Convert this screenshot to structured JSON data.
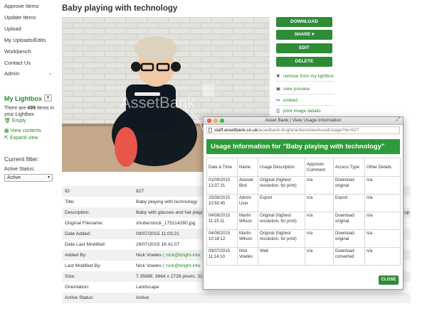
{
  "sidebar": {
    "nav": [
      {
        "label": "Approve Items"
      },
      {
        "label": "Update Items"
      },
      {
        "label": "Upload"
      },
      {
        "label": "My Uploads/Edits"
      },
      {
        "label": "Workbench"
      },
      {
        "label": "Contact Us"
      },
      {
        "label": "Admin"
      }
    ],
    "lightbox": {
      "title": "My Lightbox",
      "count_prefix": "There are ",
      "count": "499",
      "count_suffix": " items in your Lightbox",
      "empty": "Empty",
      "view_contents": "View contents",
      "expand_view": "Expand view"
    },
    "filter": {
      "title": "Current filter:",
      "label": "Active Status:",
      "value": "Active"
    }
  },
  "page": {
    "title": "Baby playing with technology",
    "watermark": "AssetBank"
  },
  "buttons": {
    "download": "DOWNLOAD",
    "share": "SHARE",
    "edit": "EDIT",
    "delete": "DELETE"
  },
  "actions": {
    "remove_lightbox": "remove from my lightbox",
    "view_preview": "view preview",
    "embed": "embed",
    "print_details": "print image details"
  },
  "details": [
    {
      "label": "ID:",
      "value": "827"
    },
    {
      "label": "Title:",
      "value": "Baby playing with technology"
    },
    {
      "label": "Description:",
      "value": "Baby with glasses and hat playi"
    },
    {
      "label": "Original Filename:",
      "value": "shutterstock_175114280.jpg"
    },
    {
      "label": "Date Added:",
      "value": "09/07/2015 11:03:21"
    },
    {
      "label": "Date Last Modified:",
      "value": "29/07/2015 16:41:07"
    },
    {
      "label": "Added By:",
      "value": "Nick Vowles",
      "link": "( nick@bright-inte"
    },
    {
      "label": "Last Modified By:",
      "value": "Nick Vowles",
      "link": "( nick@bright-inte"
    },
    {
      "label": "Size:",
      "value": "7.35MB; 3664 x 2728 pixels; 31"
    },
    {
      "label": "Orientation:",
      "value": "Landscape"
    },
    {
      "label": "Active Status:",
      "value": "Active"
    }
  ],
  "description_edge": "up",
  "popup": {
    "window_title": "Asset Bank | View Usage Information",
    "url_host": "staff.assetbank.co.uk",
    "url_path": "/assetbank-bright/action/viewAssetUsage?id=827",
    "heading": "Usage Information for \"Baby playing with technology\"",
    "columns": [
      "Date & Time",
      "Name",
      "Usage Description",
      "Approver Comment",
      "Access Type",
      "Other Details"
    ],
    "rows": [
      [
        "01/09/2015 13:37:31",
        "Alastair Bird",
        "Original (highest resolution, for print)",
        "n/a",
        "Download original",
        "n/a"
      ],
      [
        "25/08/2015 10:50:45",
        "Admin User",
        "Export",
        "n/a",
        "Export",
        "n/a"
      ],
      [
        "04/08/2015 11:15:11",
        "Martin Wilson",
        "Original (highest resolution, for print)",
        "n/a",
        "Download original",
        "n/a"
      ],
      [
        "04/08/2015 10:18:12",
        "Martin Wilson",
        "Original (highest resolution, for print)",
        "n/a",
        "Download original",
        "n/a"
      ],
      [
        "09/07/2015 11:14:10",
        "Nick Vowles",
        "Web",
        "n/a",
        "Download converted",
        "n/a"
      ]
    ],
    "close": "CLOSE"
  },
  "colors": {
    "brand_green": "#2e8b36",
    "heading_green": "#2e9a3a",
    "link_green": "#2a8a2a"
  }
}
